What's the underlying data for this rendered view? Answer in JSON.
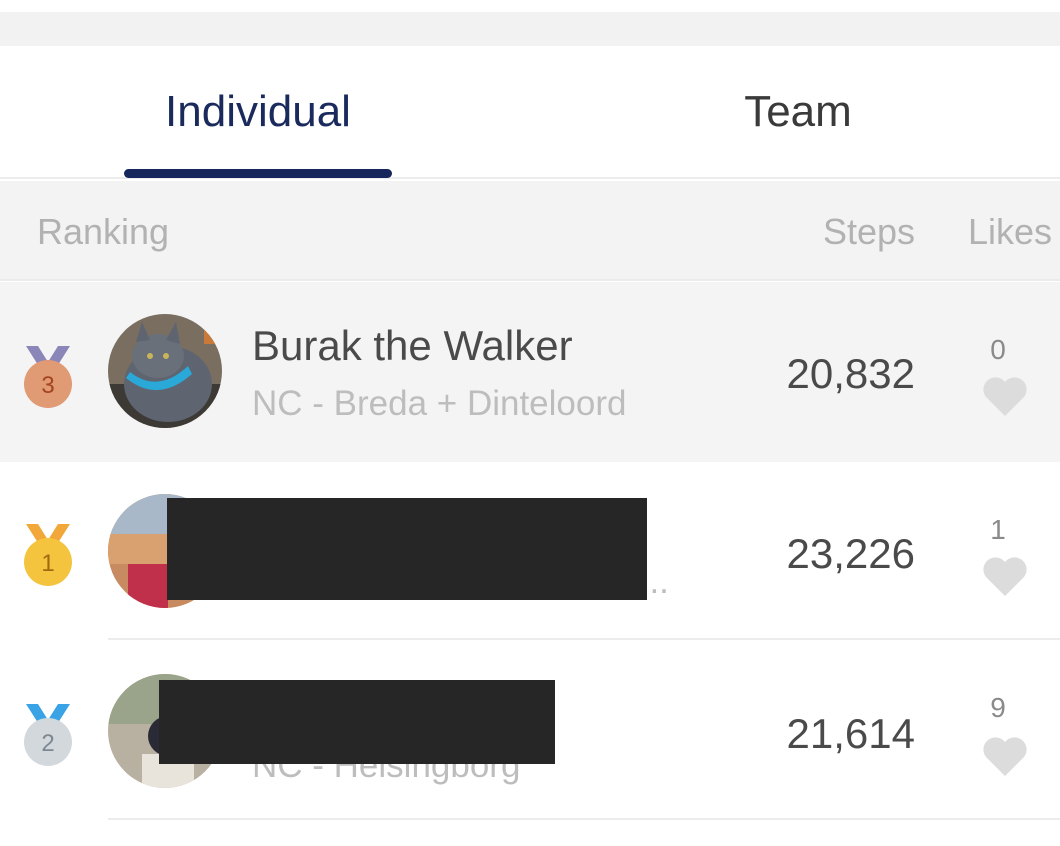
{
  "tabs": [
    {
      "label": "Individual",
      "active": true
    },
    {
      "label": "Team",
      "active": false
    }
  ],
  "columns": {
    "ranking": "Ranking",
    "steps": "Steps",
    "likes": "Likes"
  },
  "rows": [
    {
      "rank": "3",
      "medal": "bronze",
      "name": "Burak the Walker",
      "team": "NC - Breda + Dinteloord",
      "steps": "20,832",
      "likes": "0"
    },
    {
      "rank": "1",
      "medal": "gold",
      "name": "",
      "team": "t...",
      "steps": "23,226",
      "likes": "1"
    },
    {
      "rank": "2",
      "medal": "silver",
      "name": "",
      "team": "NC - Helsingborg",
      "steps": "21,614",
      "likes": "9"
    }
  ],
  "colors": {
    "accent": "#16275c",
    "bronze": "#e09a74",
    "gold": "#f4c43f",
    "silver": "#d3d8dd",
    "heart": "#dcdcdc"
  }
}
